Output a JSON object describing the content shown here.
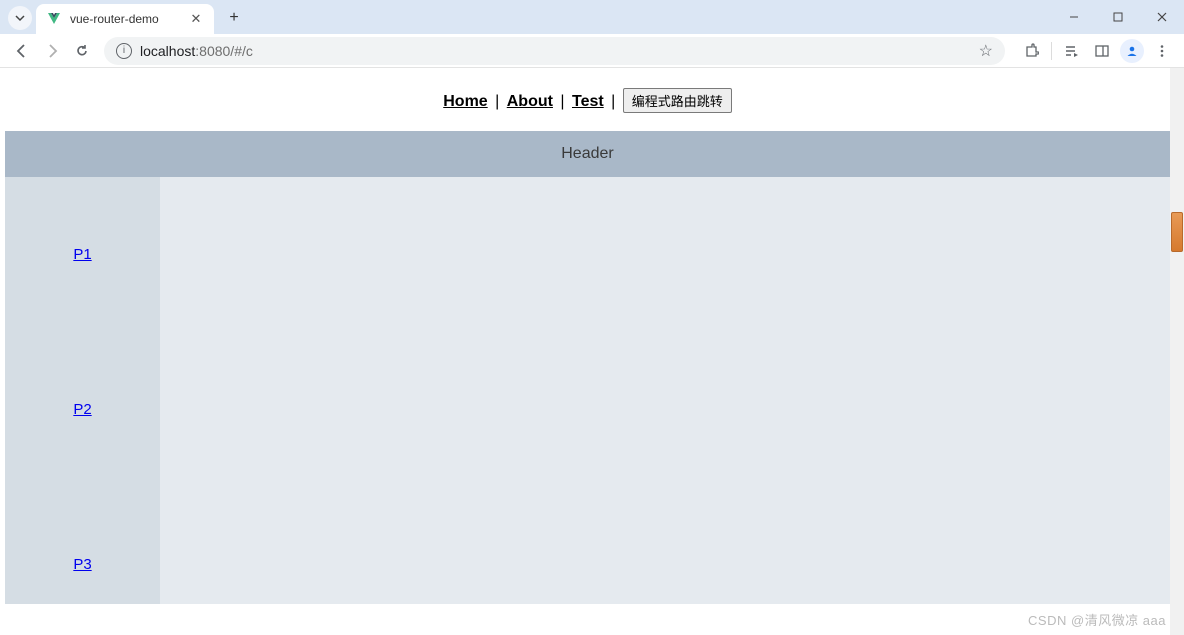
{
  "browser": {
    "tab_title": "vue-router-demo",
    "url_host": "localhost",
    "url_port_path": ":8080/#/c"
  },
  "nav": {
    "links": [
      "Home",
      "About",
      "Test"
    ],
    "separator": " | ",
    "route_button": "编程式路由跳转"
  },
  "header": {
    "text": "Header"
  },
  "sidebar": {
    "items": [
      "P1",
      "P2",
      "P3"
    ]
  },
  "watermark": "CSDN @清风微凉 aaa"
}
